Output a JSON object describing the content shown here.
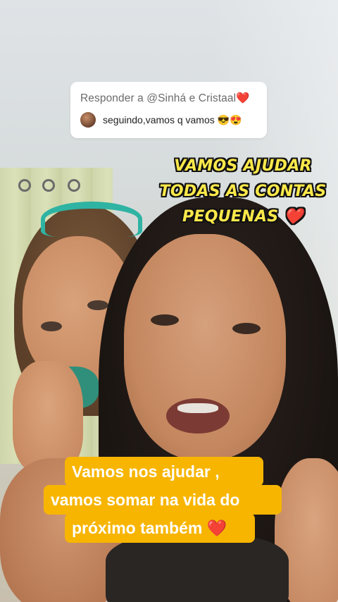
{
  "reply": {
    "title": "Responder a @Sinhá e Cristaal❤️",
    "comment": "seguindo,vamos q vamos 😎😍"
  },
  "headline": {
    "lines": [
      "VAMOS AJUDAR",
      "TODAS AS CONTAS",
      "PEQUENAS ❤️"
    ],
    "color": "#fde94a"
  },
  "caption": {
    "lines": [
      "Vamos nos ajudar  ,",
      "vamos somar na vida do",
      "próximo também ❤️"
    ],
    "background": "#f7b500"
  }
}
